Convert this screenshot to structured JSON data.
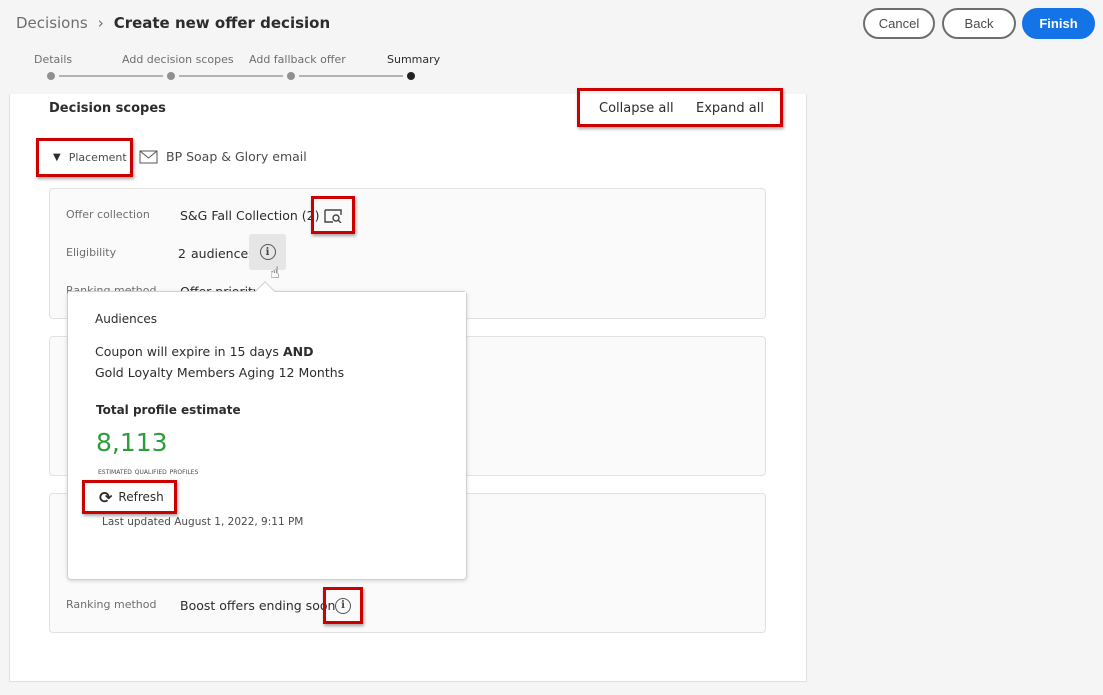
{
  "breadcrumb": {
    "parent": "Decisions",
    "current": "Create new offer decision"
  },
  "actions": {
    "cancel": "Cancel",
    "back": "Back",
    "finish": "Finish"
  },
  "steps": [
    {
      "label": "Details"
    },
    {
      "label": "Add decision scopes"
    },
    {
      "label": "Add fallback offer"
    },
    {
      "label": "Summary",
      "active": true
    }
  ],
  "section": {
    "title": "Decision scopes",
    "collapse_all": "Collapse all",
    "expand_all": "Expand all"
  },
  "placement": {
    "label": "Placement",
    "name": "BP Soap & Glory email",
    "icon": "mail-icon"
  },
  "card1": {
    "offer_collection_label": "Offer collection",
    "offer_collection_value": "S&G Fall Collection (2)",
    "eligibility_label": "Eligibility",
    "eligibility_count": "2",
    "eligibility_unit": "audiences",
    "ranking_label": "Ranking method",
    "ranking_value": "Offer priority"
  },
  "card3": {
    "ranking_label": "Ranking method",
    "ranking_value": "Boost offers ending soon"
  },
  "popover": {
    "title": "Audiences",
    "line1": "Coupon will expire in 15 days",
    "operator": "AND",
    "line2": "Gold Loyalty Members Aging 12 Months",
    "estimate_title": "Total profile estimate",
    "estimate_value": "8,113",
    "estimate_caption": "Estimated qualified profiles",
    "refresh": "Refresh",
    "last_updated": "Last updated August 1, 2022, 9:11 PM"
  },
  "colors": {
    "accent": "#1473e6",
    "estimate": "#2d9d3a",
    "highlight": "#cc0000"
  }
}
